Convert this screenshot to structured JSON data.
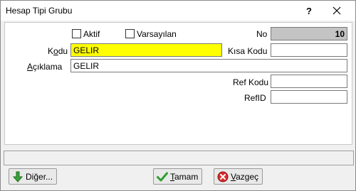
{
  "window": {
    "title": "Hesap Tipi Grubu",
    "help": "?"
  },
  "form": {
    "aktif_label": "Aktif",
    "varsayilan_label": "Varsayılan",
    "no_label": "No",
    "no_value": "10",
    "kodu_label_pre": "K",
    "kodu_label_ul": "o",
    "kodu_label_post": "du",
    "kodu_value": "GELIR",
    "kisa_kodu_label": "Kısa Kodu",
    "kisa_kodu_value": "",
    "aciklama_label_ul": "A",
    "aciklama_label_post": "çıklama",
    "aciklama_value": "GELIR",
    "ref_kodu_label": "Ref Kodu",
    "ref_kodu_value": "",
    "refid_label": "RefID",
    "refid_value": ""
  },
  "buttons": {
    "diger_pre": "Di",
    "diger_ul": "ğ",
    "diger_post": "er...",
    "tamam_ul": "T",
    "tamam_post": "amam",
    "vazgec_ul": "V",
    "vazgec_post": "azgeç"
  },
  "colors": {
    "highlight": "#ffff00",
    "readonly": "#c4c4c4"
  }
}
